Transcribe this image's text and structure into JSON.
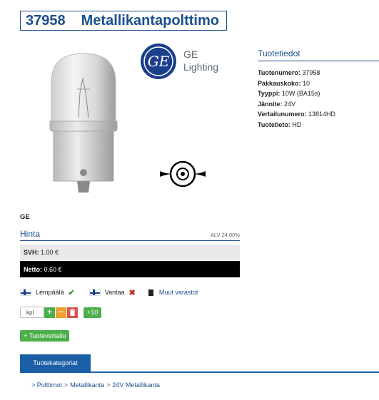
{
  "product": {
    "number": "37958",
    "name": "Metallikantapolttimo",
    "brand_logo_text": "GE",
    "brand_logo_lines": [
      "GE",
      "Lighting"
    ],
    "brand": "GE"
  },
  "info": {
    "title": "Tuotetiedot",
    "rows": [
      {
        "label": "Tuotenumero:",
        "value": "37958"
      },
      {
        "label": "Pakkauskoko:",
        "value": "10"
      },
      {
        "label": "Tyyppi:",
        "value": "10W (BA15s)"
      },
      {
        "label": "Jännite:",
        "value": "24V"
      },
      {
        "label": "Vertailunumero:",
        "value": "13814HD"
      },
      {
        "label": "Tuotetieto:",
        "value": "HD"
      }
    ]
  },
  "price": {
    "title": "Hinta",
    "vat": "ALV 24.00%",
    "retail_label": "SVH:",
    "retail_value": "1.00 €",
    "net_label": "Netto:",
    "net_value": "0.60 €"
  },
  "availability": {
    "stores": [
      {
        "name": "Lempäälä",
        "status": "✔"
      },
      {
        "name": "Vantaa",
        "status": "✖"
      }
    ],
    "other_stores": "Muut varastot"
  },
  "quantity": {
    "placeholder": "kpl",
    "plus": "+",
    "minus": "−",
    "delete_icon": "trash-icon",
    "plus10": "+10"
  },
  "compare_button": "+ Tuotevertailu",
  "categories": {
    "tab": "Tuotekategoriat",
    "prefix": ">",
    "breadcrumb": [
      "Polttimot",
      "Metallikanta",
      "24V Metallikanta"
    ],
    "separator": ">"
  },
  "colors": {
    "brand_blue": "#1a4f8b",
    "ok_green": "#2e9e2e",
    "error_red": "#c62828"
  }
}
